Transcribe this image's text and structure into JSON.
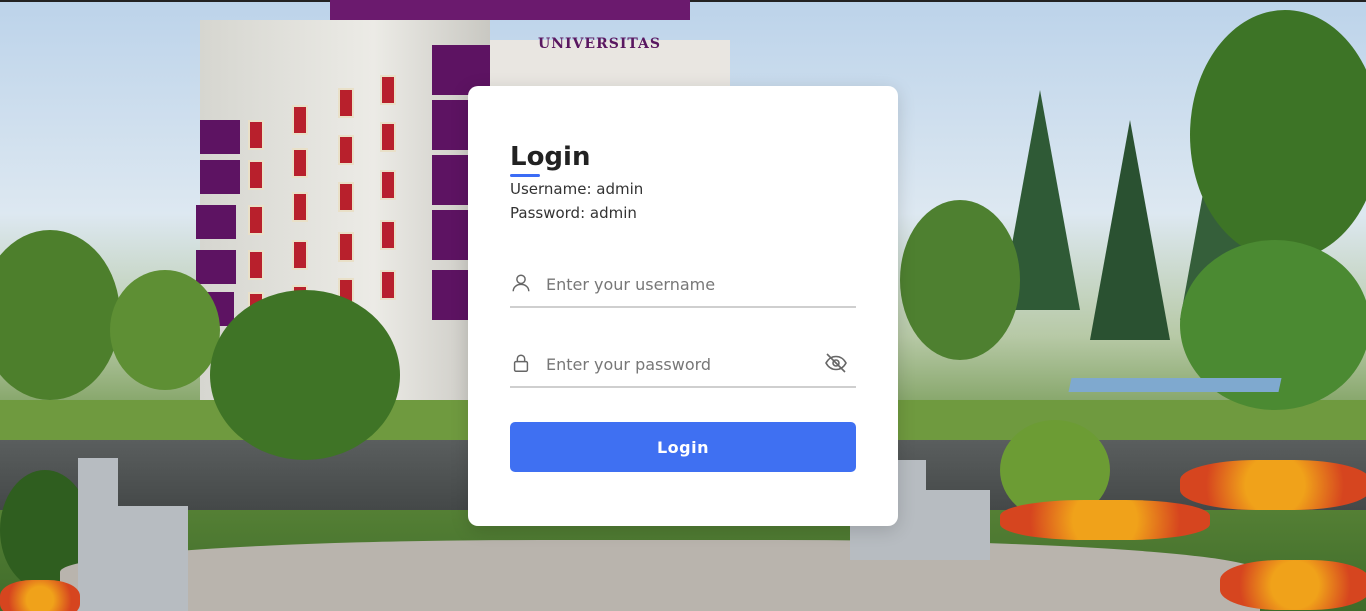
{
  "background": {
    "sign_text": "UNIVERSITAS"
  },
  "login": {
    "title": "Login",
    "hint_username": "Username: admin",
    "hint_password": "Password: admin",
    "username_placeholder": "Enter your username",
    "username_value": "",
    "password_placeholder": "Enter your password",
    "password_value": "",
    "submit_label": "Login",
    "accent_color": "#3f70f2"
  },
  "icons": {
    "username": "user-icon",
    "password": "lock-icon",
    "toggle": "eye-off-icon"
  }
}
